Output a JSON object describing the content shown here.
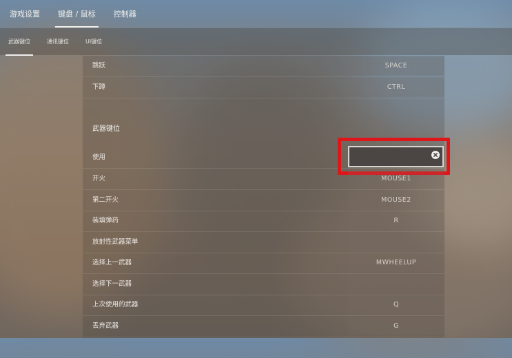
{
  "top_tabs": [
    {
      "label": "游戏设置"
    },
    {
      "label": "键盘 / 鼠标"
    },
    {
      "label": "控制器"
    }
  ],
  "sub_tabs": [
    {
      "label": "武器键位"
    },
    {
      "label": "通讯键位"
    },
    {
      "label": "UI键位"
    }
  ],
  "rows_top": [
    {
      "label": "跳跃",
      "key": "SPACE"
    },
    {
      "label": "下蹲",
      "key": "CTRL"
    }
  ],
  "section_title": "武器键位",
  "editing_row": {
    "label": "使用",
    "key": ""
  },
  "rows": [
    {
      "label": "开火",
      "key": "MOUSE1"
    },
    {
      "label": "第二开火",
      "key": "MOUSE2"
    },
    {
      "label": "装填弹药",
      "key": "R"
    },
    {
      "label": "放射性武器菜单",
      "key": ""
    },
    {
      "label": "选择上一武器",
      "key": "MWHEELUP"
    },
    {
      "label": "选择下一武器",
      "key": ""
    },
    {
      "label": "上次使用的武器",
      "key": "Q"
    },
    {
      "label": "丢弃武器",
      "key": "G"
    }
  ],
  "colors": {
    "highlight": "#e0151a",
    "edit_border": "#d8d4d0"
  }
}
